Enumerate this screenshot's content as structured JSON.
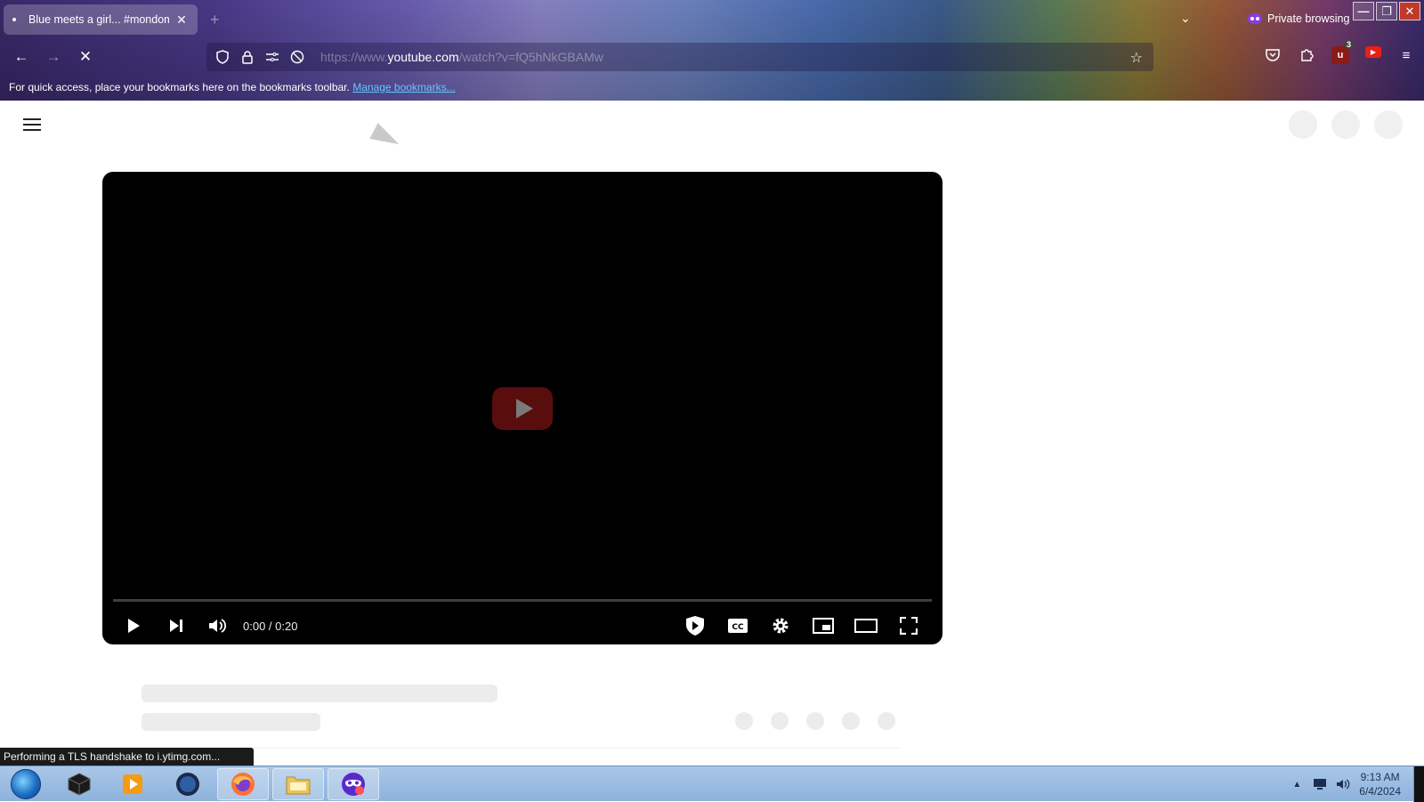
{
  "browser": {
    "tab": {
      "title": "Blue meets a girl... #mondome",
      "close": "✕"
    },
    "new_tab": "+",
    "tab_list": "⌄",
    "private_label": "Private browsing",
    "window": {
      "minimize": "—",
      "restore": "❐",
      "close": "✕"
    },
    "nav": {
      "back": "←",
      "forward": "→",
      "stop": "✕"
    },
    "url": {
      "prefix": "https://www.",
      "domain": "youtube.com",
      "path": "/watch?v=fQ5hNkGBAMw"
    },
    "ublock_badge": "3",
    "bookmarks_hint": "For quick access, place your bookmarks here on the bookmarks toolbar.",
    "manage_bookmarks": "Manage bookmarks..."
  },
  "player": {
    "time": "0:00 / 0:20",
    "progress": 0
  },
  "status_text": "Performing a TLS handshake to i.ytimg.com...",
  "taskbar": {
    "clock_time": "9:13 AM",
    "clock_date": "6/4/2024",
    "tray_arrow": "▲"
  }
}
